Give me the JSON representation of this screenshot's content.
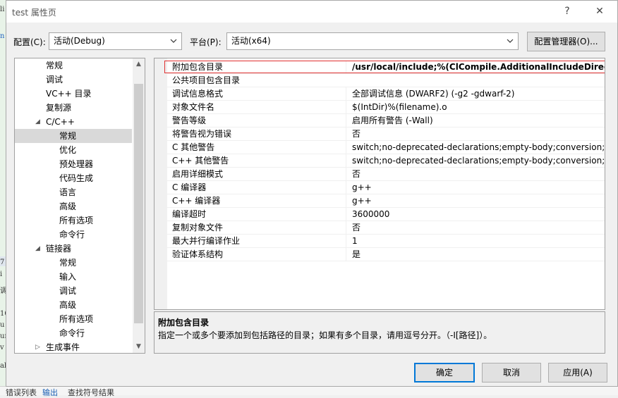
{
  "background": {
    "left_fragments": [
      "li",
      "n",
      "7",
      "i",
      "调",
      "16",
      "u",
      "ur",
      "v",
      "ab"
    ],
    "bottom_tabs": [
      "错误列表",
      "输出",
      "查找符号结果"
    ]
  },
  "window": {
    "title": "test 属性页",
    "help_glyph": "?",
    "close_glyph": "✕"
  },
  "toolbar": {
    "config_label": "配置(C):",
    "config_value": "活动(Debug)",
    "platform_label": "平台(P):",
    "platform_value": "活动(x64)",
    "config_manager_label": "配置管理器(O)..."
  },
  "tree": {
    "items": [
      {
        "label": "常规",
        "level": 1,
        "arrow": ""
      },
      {
        "label": "调试",
        "level": 1,
        "arrow": ""
      },
      {
        "label": "VC++ 目录",
        "level": 1,
        "arrow": ""
      },
      {
        "label": "复制源",
        "level": 1,
        "arrow": ""
      },
      {
        "label": "C/C++",
        "level": 1,
        "arrow": "◢"
      },
      {
        "label": "常规",
        "level": 2,
        "arrow": "",
        "selected": true
      },
      {
        "label": "优化",
        "level": 2,
        "arrow": ""
      },
      {
        "label": "预处理器",
        "level": 2,
        "arrow": ""
      },
      {
        "label": "代码生成",
        "level": 2,
        "arrow": ""
      },
      {
        "label": "语言",
        "level": 2,
        "arrow": ""
      },
      {
        "label": "高级",
        "level": 2,
        "arrow": ""
      },
      {
        "label": "所有选项",
        "level": 2,
        "arrow": ""
      },
      {
        "label": "命令行",
        "level": 2,
        "arrow": ""
      },
      {
        "label": "链接器",
        "level": 1,
        "arrow": "◢"
      },
      {
        "label": "常规",
        "level": 2,
        "arrow": ""
      },
      {
        "label": "输入",
        "level": 2,
        "arrow": ""
      },
      {
        "label": "调试",
        "level": 2,
        "arrow": ""
      },
      {
        "label": "高级",
        "level": 2,
        "arrow": ""
      },
      {
        "label": "所有选项",
        "level": 2,
        "arrow": ""
      },
      {
        "label": "命令行",
        "level": 2,
        "arrow": ""
      },
      {
        "label": "生成事件",
        "level": 1,
        "arrow": "▷"
      }
    ]
  },
  "grid": {
    "rows": [
      {
        "name": "附加包含目录",
        "value": "/usr/local/include;%(ClCompile.AdditionalIncludeDirectories)",
        "bold": true,
        "highlighted": true
      },
      {
        "name": "公共项目包含目录",
        "value": ""
      },
      {
        "name": "调试信息格式",
        "value": "全部调试信息 (DWARF2) (-g2 -gdwarf-2)"
      },
      {
        "name": "对象文件名",
        "value": "$(IntDir)%(filename).o"
      },
      {
        "name": "警告等级",
        "value": "启用所有警告 (-Wall)"
      },
      {
        "name": "将警告视为错误",
        "value": "否"
      },
      {
        "name": "C 其他警告",
        "value": "switch;no-deprecated-declarations;empty-body;conversion;return-type;parentheses;no-format;uninitialized;unreachable-code;unused-function;unused-value;unused-variable"
      },
      {
        "name": "C++ 其他警告",
        "value": "switch;no-deprecated-declarations;empty-body;conversion;return-type;parentheses;no-format;uninitialized;unreachable-code;unused-function;unused-value;unused-variable"
      },
      {
        "name": "启用详细模式",
        "value": "否"
      },
      {
        "name": "C 编译器",
        "value": "g++"
      },
      {
        "name": "C++ 编译器",
        "value": "g++"
      },
      {
        "name": "编译超时",
        "value": "3600000"
      },
      {
        "name": "复制对象文件",
        "value": "否"
      },
      {
        "name": "最大并行编译作业",
        "value": "1"
      },
      {
        "name": "验证体系结构",
        "value": "是"
      }
    ]
  },
  "description": {
    "title": "附加包含目录",
    "text": "指定一个或多个要添加到包括路径的目录；如果有多个目录，请用逗号分开。（-I[路径]）。"
  },
  "buttons": {
    "ok": "确定",
    "cancel": "取消",
    "apply": "应用(A)"
  }
}
